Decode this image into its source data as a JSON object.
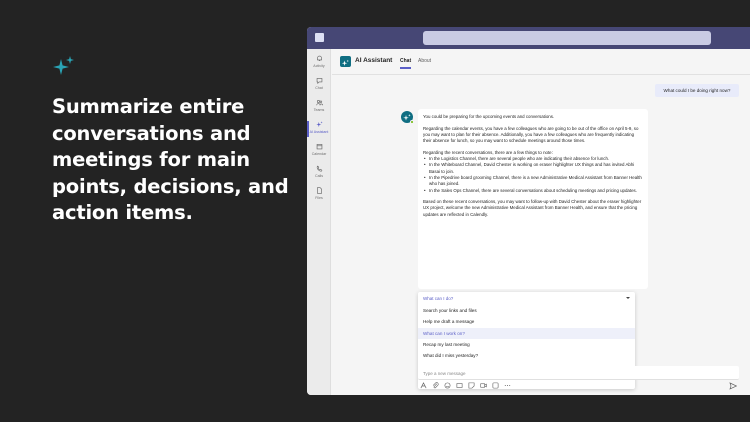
{
  "marketing": {
    "headline": "Summarize entire conversations and meetings for main points, decisions, and action items.",
    "sparkle_icon": "sparkle-icon",
    "accent_color": "#2aa3b4"
  },
  "app": {
    "titlebar_color": "#464775",
    "rail": [
      {
        "label": "Activity",
        "icon": "bell-icon"
      },
      {
        "label": "Chat",
        "icon": "chat-icon"
      },
      {
        "label": "Teams",
        "icon": "teams-icon"
      },
      {
        "label": "AI Assistant",
        "icon": "sparkle-icon"
      },
      {
        "label": "Calendar",
        "icon": "calendar-icon"
      },
      {
        "label": "Calls",
        "icon": "phone-icon"
      },
      {
        "label": "Files",
        "icon": "file-icon"
      }
    ],
    "header": {
      "title": "AI Assistant",
      "tabs": [
        "Chat",
        "About"
      ]
    },
    "user_message": "What could I be doing right now?",
    "bot_message": {
      "intro": "You could be preparing for the upcoming events and conversations.",
      "calendar_paragraph": "Regarding the calendar events, you have a few colleagues who are going to be out of the office on April 5-9, so you may want to plan for their absence. Additionally, you have a few colleagues who are frequently indicating their absence for lunch, so you may want to schedule meetings around those times.",
      "recent_intro": "Regarding the recent conversations, there are a few things to note:",
      "bullets": [
        "In the Logistics Channel, there are several people who are indicating their absence for lunch.",
        "In the Whiteboard Channel, David Chester is working on eraser highlighter UX things and has invited Abhi Basai to join.",
        "In the Pipedrive board grooming Channel, there is a new Administrative Medical Assistant from Banner Health who has joined.",
        "In the Sales Ops Channel, there are several conversations about scheduling meetings and pricing updates."
      ],
      "conclusion": "Based on these recent conversations, you may want to follow-up with David Chester about the eraser highlighter UX project, welcome the new Administrative Medical Assistant from Banner Health, and ensure that the pricing updates are reflected in Calendly."
    },
    "dropdown": {
      "header": "What can I do?",
      "items": [
        "Search your links and files",
        "Help me draft a message",
        "What can I work on?",
        "Recap my last meeting",
        "What did I miss yesterday?"
      ],
      "selected_index": 2
    },
    "composer": {
      "placeholder": "Type a new message",
      "tools": [
        "format-icon",
        "attach-icon",
        "emoji-icon",
        "gif-icon",
        "sticker-icon",
        "meet-icon",
        "loop-icon",
        "more-icon"
      ],
      "send_icon": "send-icon"
    }
  }
}
